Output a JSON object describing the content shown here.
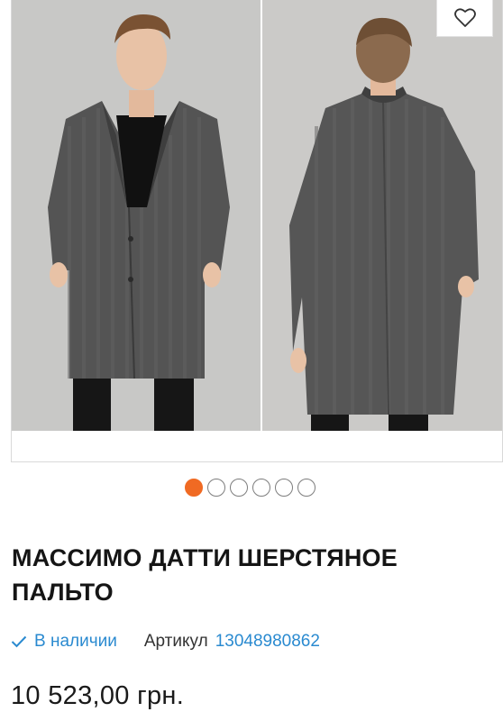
{
  "gallery": {
    "images": [
      {
        "icon": "model-front-photo"
      },
      {
        "icon": "model-back-photo"
      }
    ],
    "wishlist_icon": "heart-icon",
    "dots_total": 6,
    "dots_active_index": 0,
    "colors": {
      "active_dot": "#f06a23",
      "inactive_dot": "#7d7d7d"
    }
  },
  "product": {
    "title": "МАССИМО ДАТТИ ШЕРСТЯНОЕ ПАЛЬТО",
    "stock_status": "В наличии",
    "stock_icon": "check-icon",
    "sku_label": "Артикул",
    "sku_value": "13048980862",
    "price": "10 523,00 грн.",
    "colors": {
      "link": "#2a8ad0"
    }
  }
}
